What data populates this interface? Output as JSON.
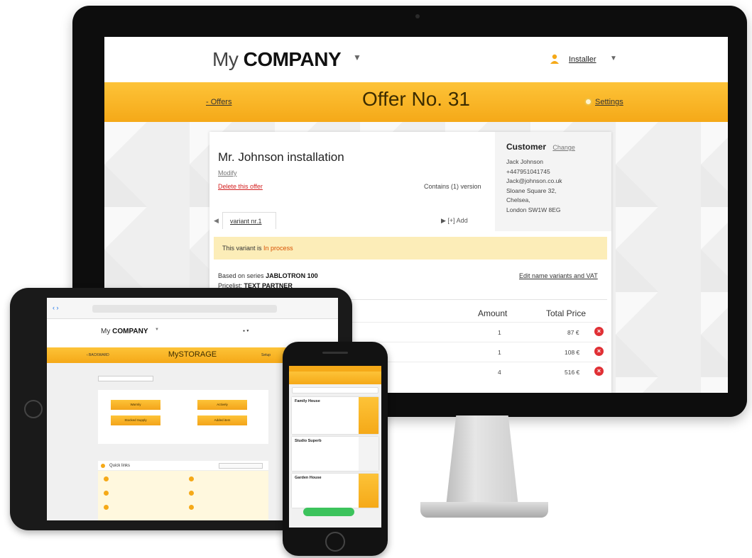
{
  "desktop": {
    "brand": {
      "my": "My",
      "company": "COMPANY"
    },
    "user": {
      "label": "Installer"
    },
    "nav": {
      "offers_link": "- Offers",
      "title": "Offer No. 31",
      "settings_link": "Settings"
    },
    "offer": {
      "name": "Mr. Johnson installation",
      "modify": "Modify",
      "delete": "Delete this offer",
      "versions": "Contains (1) version",
      "variant_tab": "variant nr.1",
      "add_variant": "[+] Add",
      "status_prefix": "This variant is",
      "status_value": "In process",
      "based_on_label": "Based on series",
      "based_on_value": "JABLOTRON 100",
      "pricelist_label": "Pricelist:",
      "pricelist_value": "TEXT PARTNER",
      "edit_link": "Edit name variants and VAT"
    },
    "customer": {
      "heading": "Customer",
      "change": "Change",
      "lines": [
        "Jack Johnson",
        "+447951041745",
        "Jack@johnson.co.uk",
        "Sloane Square 32,",
        "Chelsea,",
        "London SW1W 8EG"
      ]
    },
    "table": {
      "headers": {
        "amount": "Amount",
        "total": "Total Price"
      },
      "rows": [
        {
          "amount": "1",
          "total": "87 €"
        },
        {
          "amount": "1",
          "total": "108 €"
        },
        {
          "amount": "4",
          "total": "516 €"
        }
      ]
    }
  },
  "tablet": {
    "brand": {
      "my": "My",
      "company": "COMPANY"
    },
    "title": "MySTORAGE",
    "back": "‹ BACKWARD",
    "settings": "Setup",
    "buttons": [
      "Warmly",
      "Actively",
      "Stocked Supply",
      "Added item"
    ],
    "quick": {
      "heading": "Quick links"
    }
  },
  "phone": {
    "cards": [
      {
        "title": "Family House"
      },
      {
        "title": "Studio Superb"
      },
      {
        "title": "Garden House"
      }
    ]
  },
  "colors": {
    "accent": "#f5a918",
    "danger": "#e03035",
    "status_bg": "#fcedb8"
  }
}
